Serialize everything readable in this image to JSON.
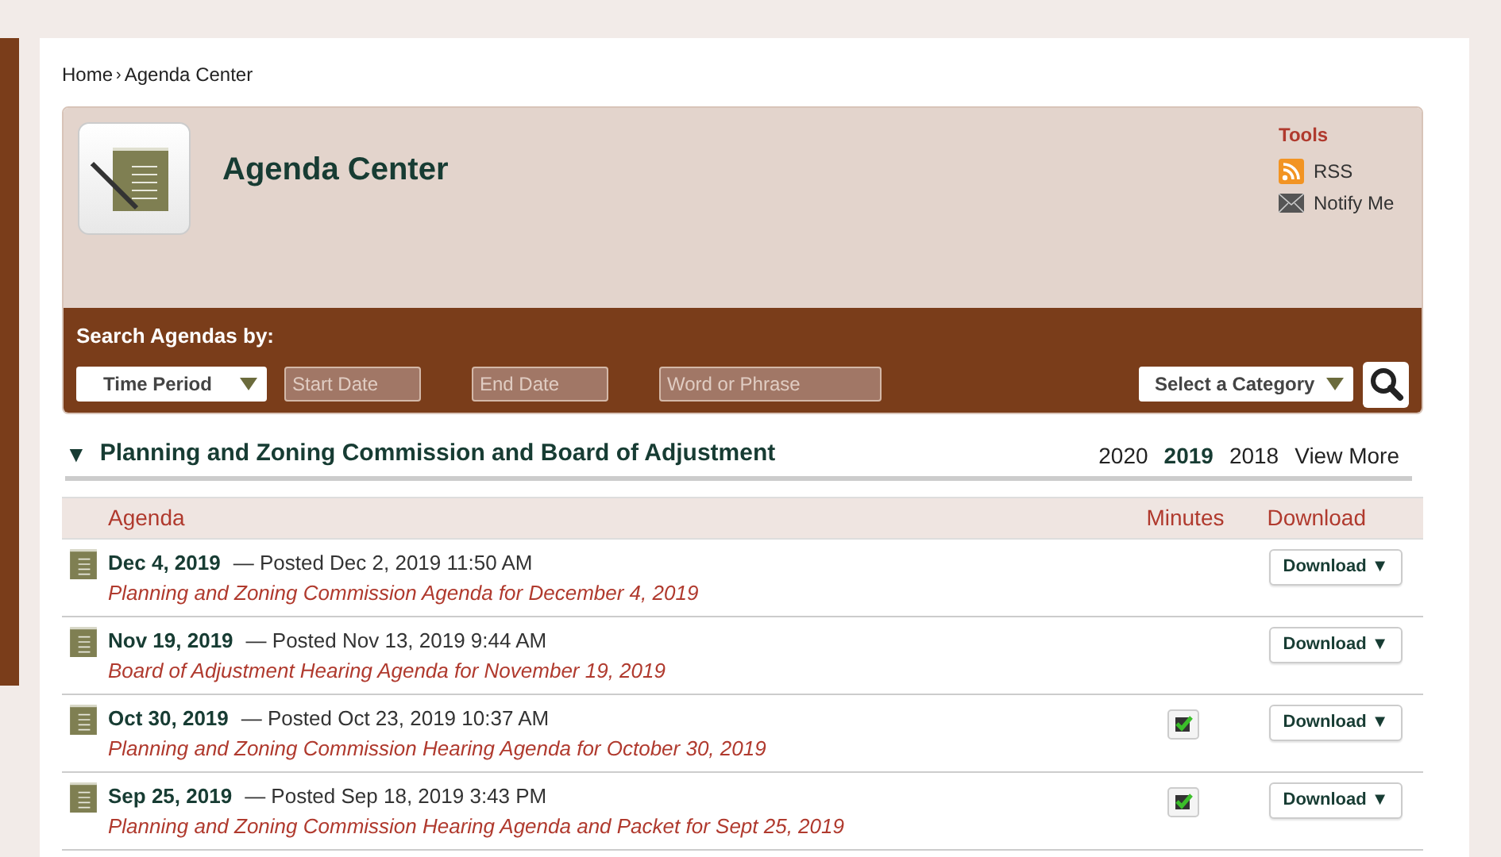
{
  "breadcrumb": {
    "home": "Home",
    "separator": "›",
    "current": "Agenda Center"
  },
  "header": {
    "title": "Agenda Center",
    "tools": {
      "heading": "Tools",
      "links": [
        {
          "kind": "rss",
          "label": "RSS"
        },
        {
          "kind": "mail",
          "label": "Notify Me"
        }
      ]
    }
  },
  "search": {
    "label": "Search Agendas by:",
    "time_period": "Time Period",
    "start_placeholder": "Start Date",
    "end_placeholder": "End Date",
    "word_placeholder": "Word or Phrase",
    "category": "Select a Category"
  },
  "section": {
    "title": "Planning and Zoning Commission and Board of Adjustment",
    "expanded": true,
    "toggle": "▼",
    "years": [
      {
        "label": "2020",
        "selected": false
      },
      {
        "label": "2019",
        "selected": true
      },
      {
        "label": "2018",
        "selected": false
      }
    ],
    "view_more": "View More"
  },
  "table": {
    "columns": [
      "Agenda",
      "Minutes",
      "Download"
    ],
    "rows": [
      {
        "date": "Dec 4, 2019",
        "posted": "— Posted Dec 2, 2019 11:50 AM",
        "title": "Planning and Zoning Commission Agenda for December 4, 2019",
        "minutes": false,
        "download": "Download ▼"
      },
      {
        "date": "Nov 19, 2019",
        "posted": "— Posted Nov 13, 2019 9:44 AM",
        "title": "Board of Adjustment Hearing Agenda for November 19, 2019",
        "minutes": false,
        "download": "Download ▼"
      },
      {
        "date": "Oct 30, 2019",
        "posted": "— Posted Oct 23, 2019 10:37 AM",
        "title": "Planning and Zoning Commission Hearing Agenda for October 30, 2019",
        "minutes": true,
        "download": "Download ▼"
      },
      {
        "date": "Sep 25, 2019",
        "posted": "— Posted Sep 18, 2019 3:43 PM",
        "title": "Planning and Zoning Commission Hearing Agenda and Packet for Sept 25, 2019",
        "minutes": true,
        "download": "Download ▼"
      }
    ]
  }
}
